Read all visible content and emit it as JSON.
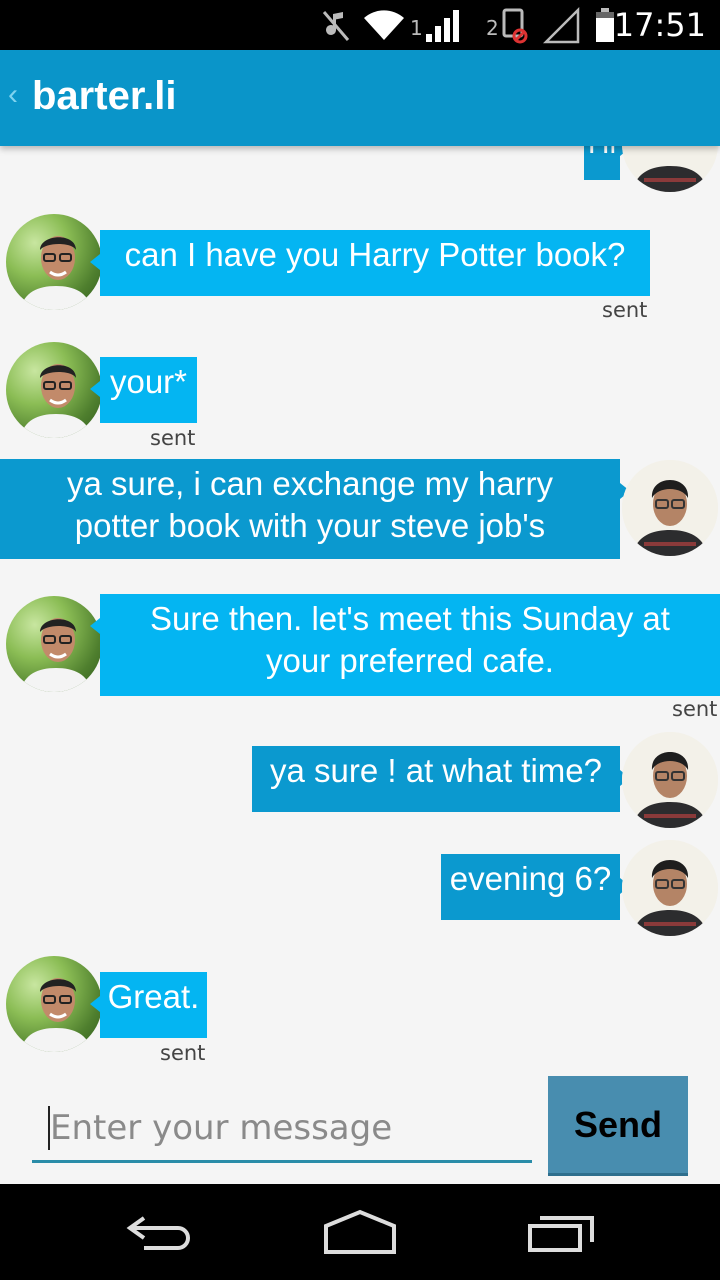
{
  "status": {
    "time": "17:51",
    "sim1": "1",
    "sim2": "2"
  },
  "app": {
    "title": "barter.li"
  },
  "messages": {
    "m0": {
      "text": "Hi"
    },
    "m1": {
      "text": "can I have you Harry Potter book?",
      "status": "sent"
    },
    "m2": {
      "text": "your*",
      "status": "sent"
    },
    "m3": {
      "text": "ya sure, i can exchange my harry potter book with your steve job's"
    },
    "m4": {
      "text": "Sure then. let's meet this Sunday at your preferred cafe.",
      "status": "sent"
    },
    "m5": {
      "text": "ya sure ! at what time?"
    },
    "m6": {
      "text": "evening 6?"
    },
    "m7": {
      "text": "Great.",
      "status": "sent"
    }
  },
  "composer": {
    "placeholder": "Enter your message",
    "send_label": "Send"
  }
}
